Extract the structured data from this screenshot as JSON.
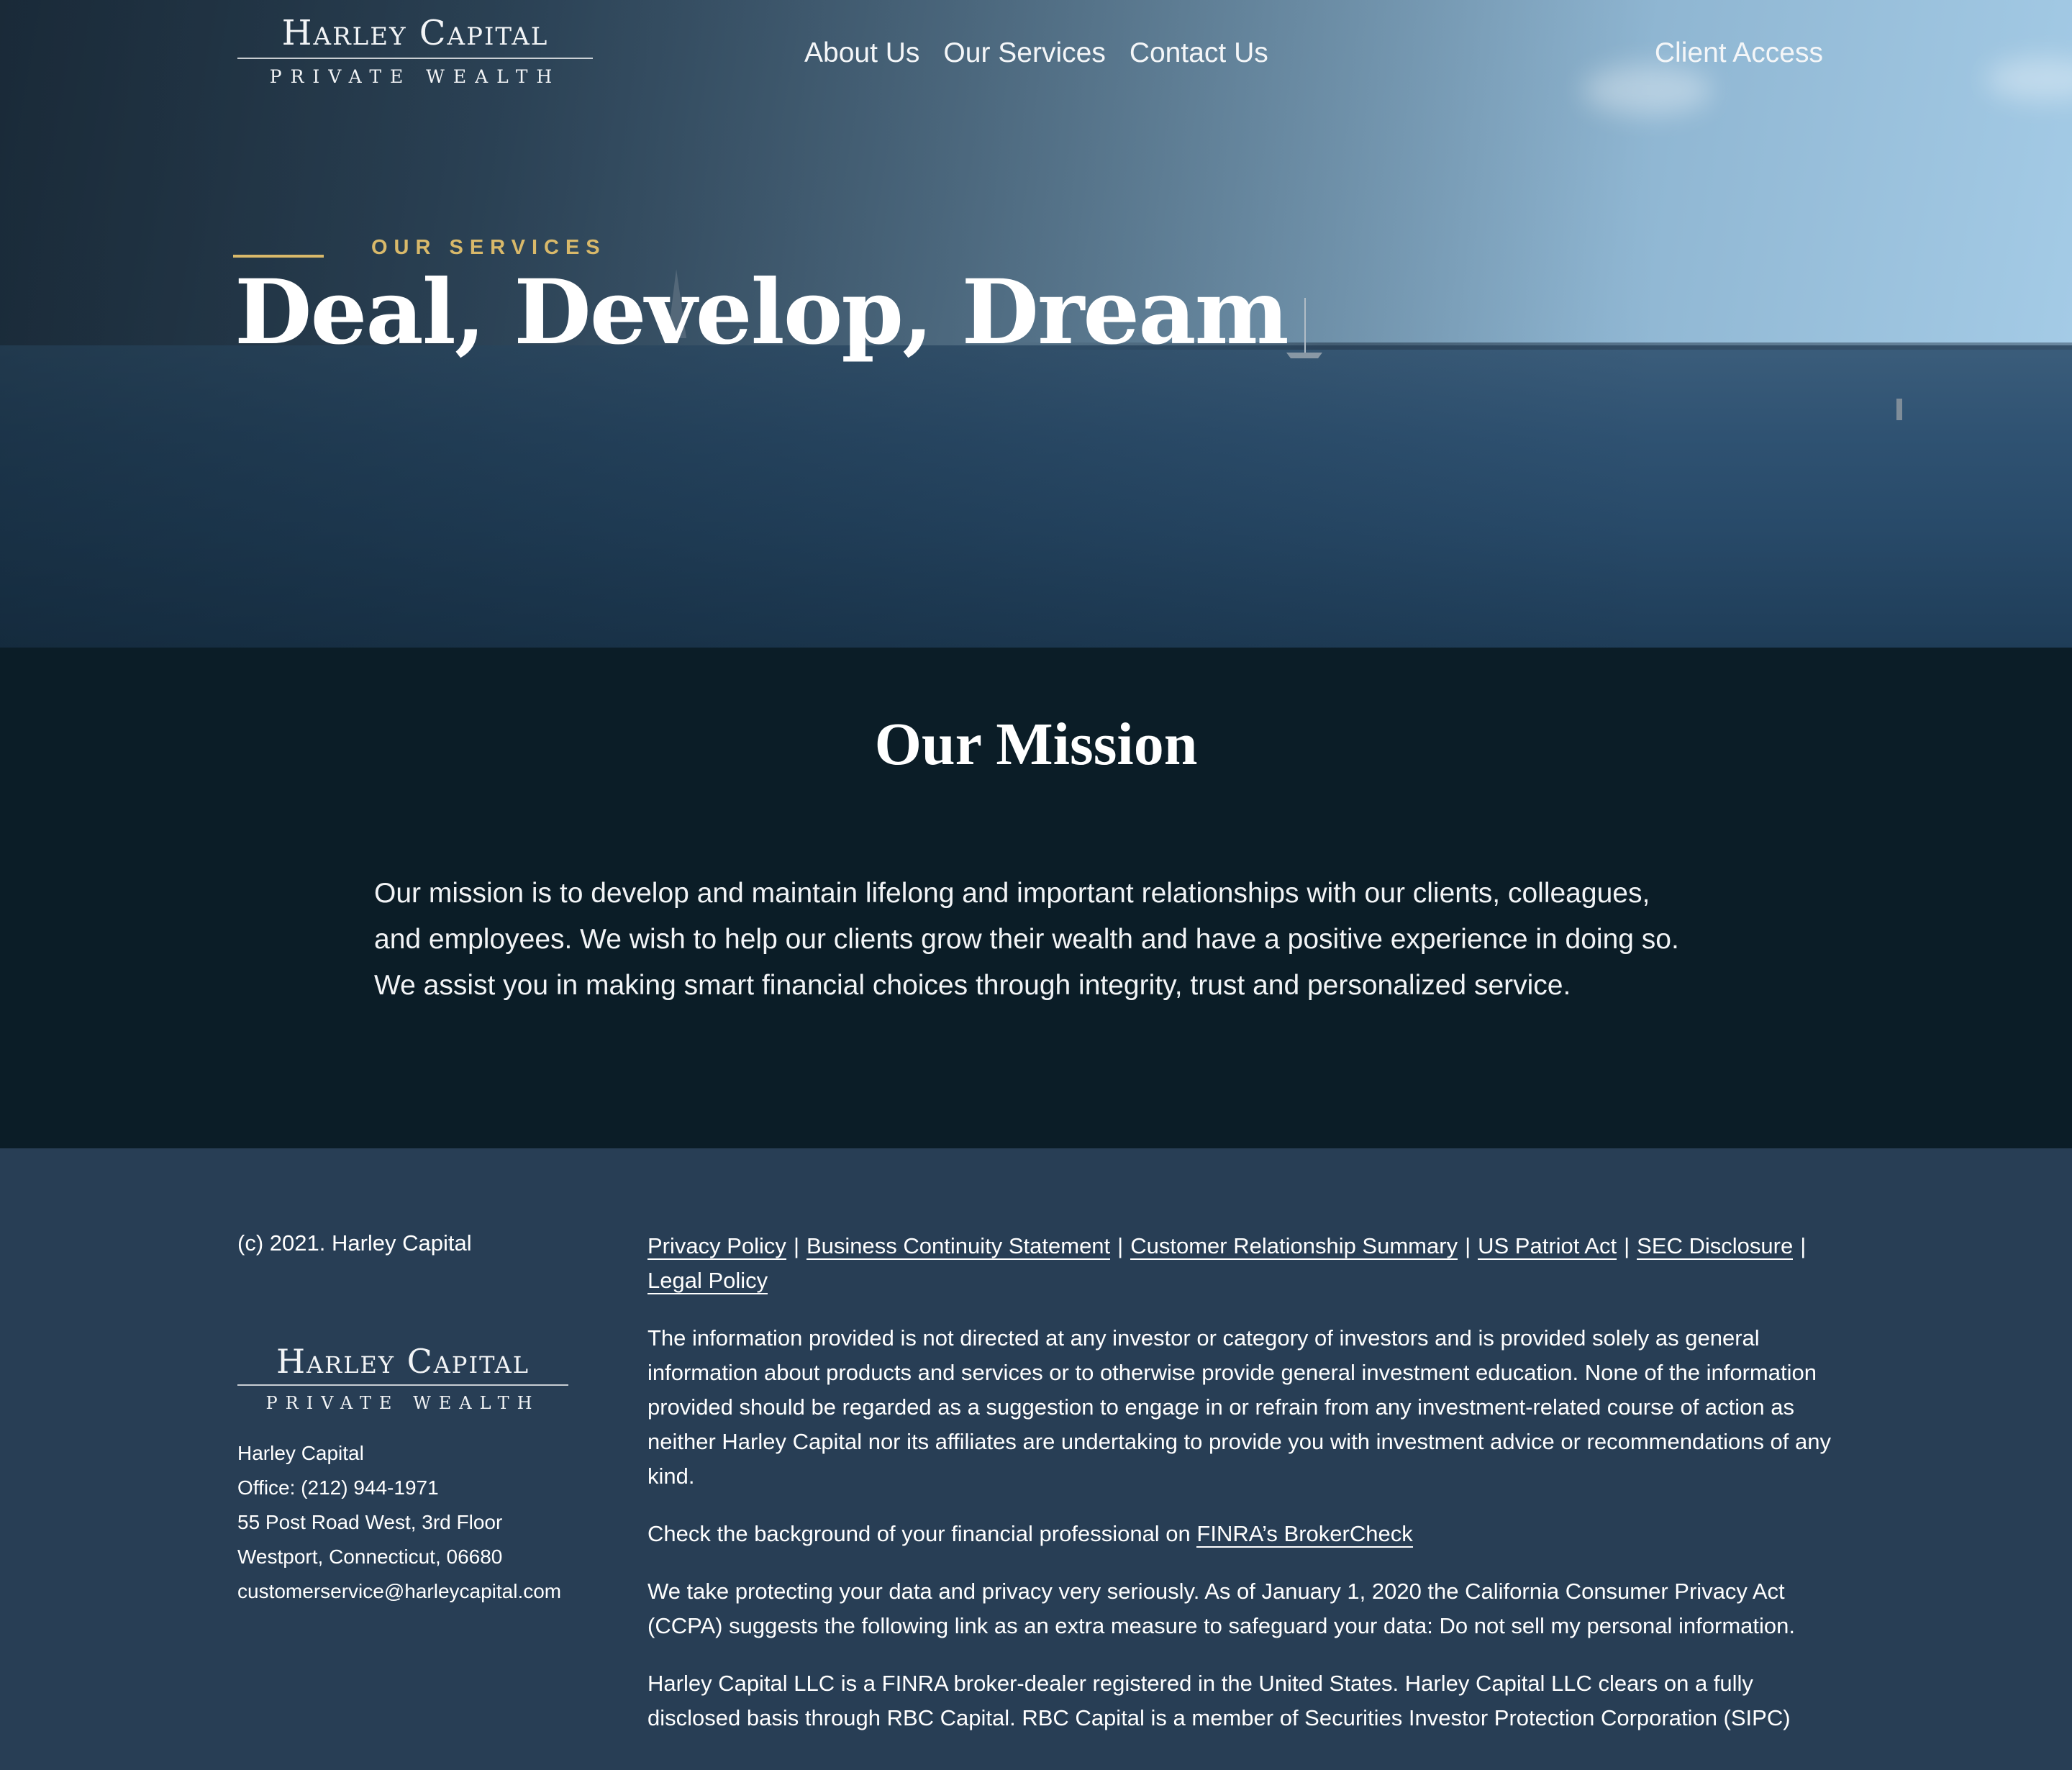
{
  "brand": {
    "name": "Harley Capital",
    "tagline": "PRIVATE WEALTH"
  },
  "nav": {
    "items": [
      {
        "label": "About Us"
      },
      {
        "label": "Our Services"
      },
      {
        "label": "Contact Us"
      }
    ],
    "client_access": "Client Access"
  },
  "hero": {
    "eyebrow": "OUR SERVICES",
    "title": "Deal, Develop, Dream"
  },
  "mission": {
    "title": "Our Mission",
    "text": "Our mission is to develop and maintain lifelong and important relationships with our clients, colleagues, and employees. We wish to help our clients grow their wealth and have a positive experience in doing so. We assist you in making smart financial choices through integrity, trust and personalized service."
  },
  "footer": {
    "copyright": "(c) 2021. Harley Capital",
    "contact": {
      "name": "Harley Capital",
      "office": "Office: (212) 944-1971",
      "address1": "55 Post Road West, 3rd Floor",
      "address2": "Westport, Connecticut, 06680",
      "email": "customerservice@harleycapital.com"
    },
    "links": [
      "Privacy Policy",
      "Business Continuity Statement",
      "Customer Relationship Summary",
      "US Patriot Act",
      "SEC Disclosure",
      "Legal Policy"
    ],
    "separator": "|",
    "disclaimer": "The information provided is not directed at any investor or category of investors and is provided solely as general information about products and services or to otherwise provide general investment education. None of the information provided should be regarded as a suggestion to engage in or refrain from any investment-related course of action as neither Harley Capital nor its affiliates are undertaking to provide you with investment advice or recommendations of any kind.",
    "brokercheck_prefix": "Check the background of your financial professional on ",
    "brokercheck_link": "FINRA’s BrokerCheck",
    "privacy": "We take protecting your data and privacy very seriously. As of January 1, 2020 the California Consumer Privacy Act (CCPA) suggests the following link as an extra measure to safeguard your data: Do not sell my personal information.",
    "finra": "Harley Capital LLC is a FINRA broker-dealer registered in the United States. Harley Capital LLC clears on a fully disclosed basis through RBC Capital. RBC Capital is a member of Securities Investor Protection Corporation (SIPC)"
  }
}
